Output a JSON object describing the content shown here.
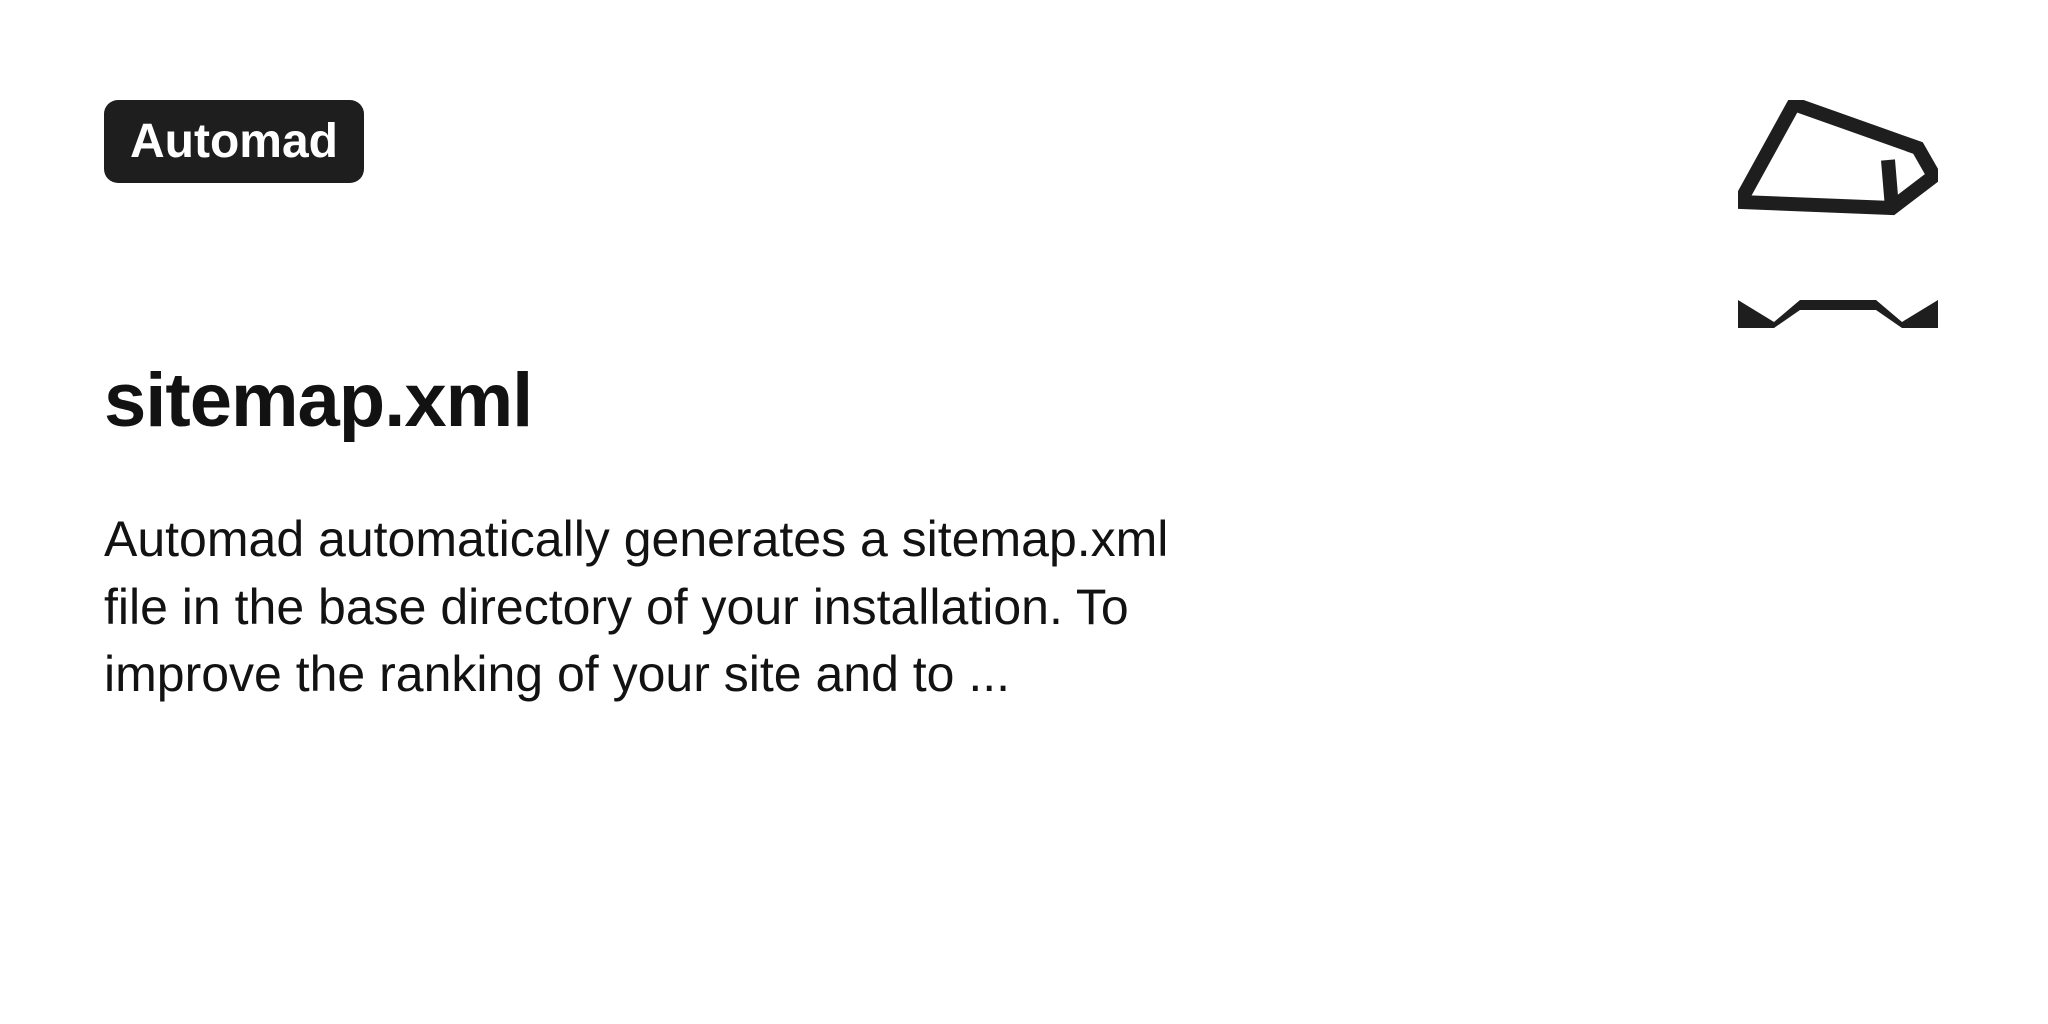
{
  "badge": {
    "label": "Automad"
  },
  "title": "sitemap.xml",
  "description": "Automad automatically generates a sitemap.xml file in the base directory of your installation. To improve the ranking of your site and to ..."
}
